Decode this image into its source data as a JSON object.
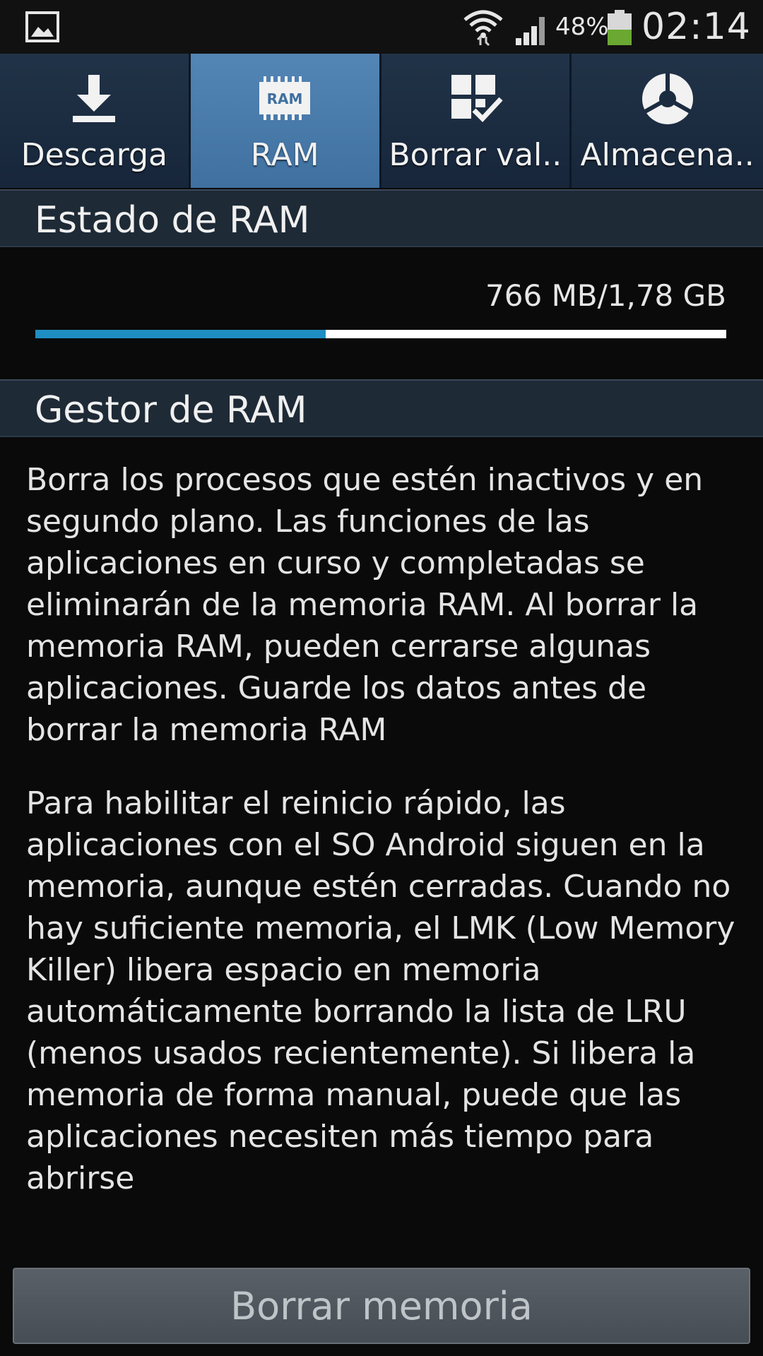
{
  "status_bar": {
    "battery_percent": "48%",
    "time": "02:14",
    "icons": [
      "gallery-icon",
      "wifi-icon",
      "signal-icon",
      "battery-icon"
    ],
    "battery_color": "#6aa832"
  },
  "tabs": [
    {
      "label": "Descarga",
      "icon": "download-icon",
      "active": false
    },
    {
      "label": "RAM",
      "icon": "ram-chip-icon",
      "active": true,
      "icon_text": "RAM"
    },
    {
      "label": "Borrar val..",
      "icon": "clear-defaults-icon",
      "active": false
    },
    {
      "label": "Almacena..",
      "icon": "storage-pie-icon",
      "active": false
    }
  ],
  "ram_status": {
    "title": "Estado de RAM",
    "usage_text": "766 MB/1,78 GB",
    "used_fraction": 0.42,
    "bar_color": "#1e8ec2"
  },
  "ram_manager": {
    "title": "Gestor de RAM",
    "paragraph1": "Borra los procesos que estén inactivos y en segundo plano. Las funciones de las aplicaciones en curso y completadas se eliminarán de la memoria RAM. Al borrar la memoria RAM, pueden cerrarse algunas aplicaciones. Guarde los datos antes de borrar la memoria RAM",
    "paragraph2": "Para habilitar el reinicio rápido, las aplicaciones con el SO Android siguen en la memoria, aunque estén cerradas. Cuando no hay suficiente memoria, el LMK (Low Memory Killer) libera espacio en memoria automáticamente borrando la lista de LRU (menos usados recientemente). Si libera la memoria de forma manual, puede que las aplicaciones necesiten más tiempo para abrirse",
    "button_label": "Borrar memoria"
  }
}
